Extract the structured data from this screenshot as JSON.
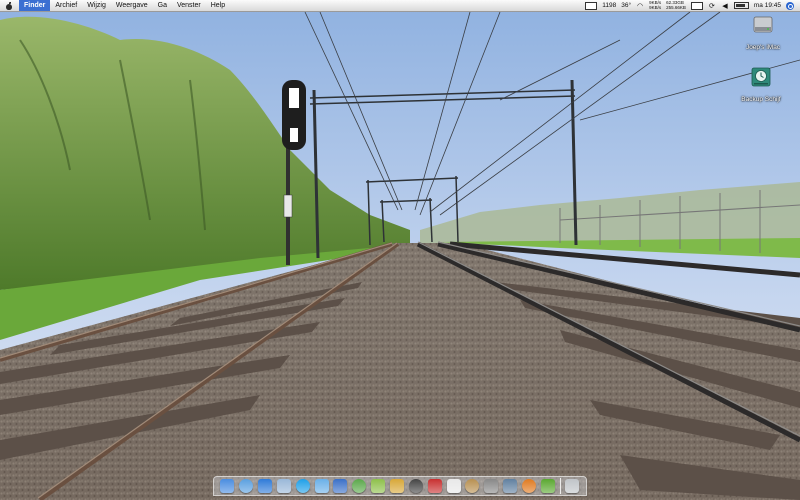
{
  "menubar": {
    "app_name": "Finder",
    "items": [
      "Archief",
      "Wijzig",
      "Weergave",
      "Ga",
      "Venster",
      "Help"
    ],
    "highlighted_index": 0,
    "status": {
      "cpu": "1198",
      "temperature": "36°",
      "net_up": "9KB/s",
      "net_down": "9KB/s",
      "mem_top": "62.33GB",
      "mem_bottom": "255.66KB",
      "clock": "ma 19:45",
      "icons": [
        "wifi-icon",
        "sync-icon",
        "volume-icon",
        "battery-icon",
        "spotlight-icon"
      ]
    }
  },
  "desktop": {
    "icons": [
      {
        "label": "Joep's iMac",
        "icon": "hard-drive-icon"
      },
      {
        "label": "Backup Schijf",
        "icon": "time-machine-icon"
      }
    ]
  },
  "dock": {
    "items": [
      {
        "icon": "finder-icon",
        "color": "#4a8de0"
      },
      {
        "icon": "globe-icon",
        "color": "#5aa0e0"
      },
      {
        "icon": "safari-icon",
        "color": "#2f7bd8"
      },
      {
        "icon": "mail-icon",
        "color": "#9ab8d8"
      },
      {
        "icon": "skype-icon",
        "color": "#1fa0e8"
      },
      {
        "icon": "ichat-icon",
        "color": "#6ab0e8"
      },
      {
        "icon": "itunes-icon",
        "color": "#3a70c8"
      },
      {
        "icon": "iphoto-icon",
        "color": "#5aa84a"
      },
      {
        "icon": "garageband-icon",
        "color": "#8ec04a"
      },
      {
        "icon": "preview-icon",
        "color": "#d8a838"
      },
      {
        "icon": "terminal-icon",
        "color": "#444444"
      },
      {
        "icon": "photobooth-icon",
        "color": "#c83030"
      },
      {
        "icon": "ical-icon",
        "color": "#e8e8e8"
      },
      {
        "icon": "address-book-icon",
        "color": "#b89050"
      },
      {
        "icon": "system-prefs-icon",
        "color": "#888888"
      },
      {
        "icon": "utility-icon",
        "color": "#6080a0"
      },
      {
        "icon": "firefox-icon",
        "color": "#e07a20"
      },
      {
        "icon": "adium-icon",
        "color": "#5aa830"
      },
      {
        "icon": "trash-icon",
        "color": "#c0c4c8"
      }
    ]
  },
  "colors": {
    "menu_highlight": "#3b6fd2",
    "sky": "#b7cdeb",
    "grass": "#6aa83a"
  }
}
